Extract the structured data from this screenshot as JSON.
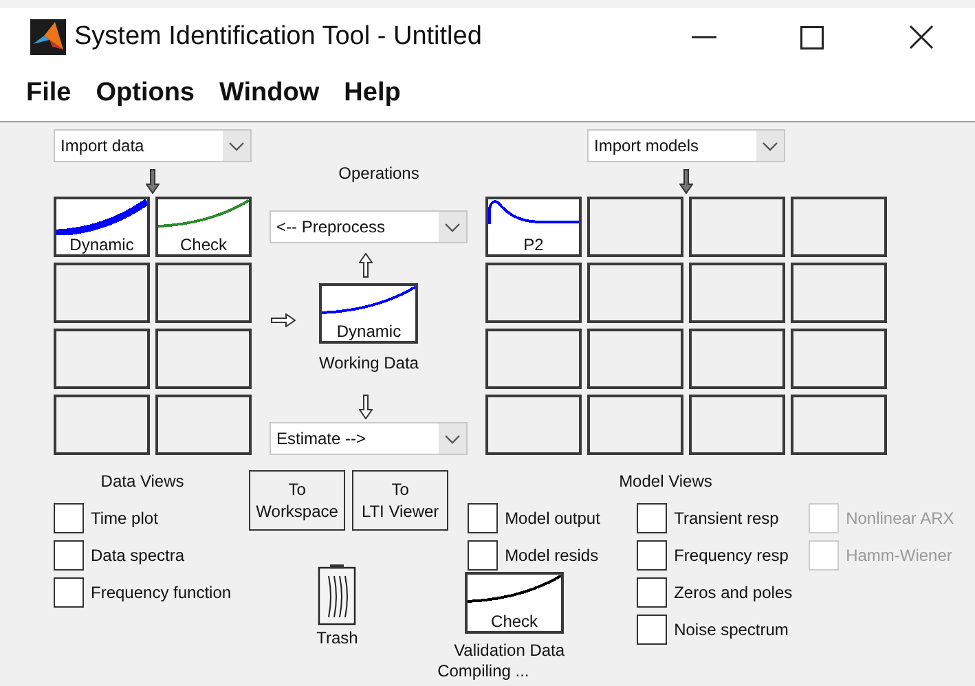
{
  "window": {
    "title": "System Identification Tool - Untitled"
  },
  "menu": [
    "File",
    "Options",
    "Window",
    "Help"
  ],
  "data_panel": {
    "import": {
      "value": "Import data"
    },
    "tiles": [
      {
        "kind": "thick-curve",
        "label": "Dynamic",
        "color": "#0000ff"
      },
      {
        "kind": "curve",
        "label": "Check",
        "color": "#2e8b2e"
      },
      {
        "kind": "empty"
      },
      {
        "kind": "empty"
      },
      {
        "kind": "empty"
      },
      {
        "kind": "empty"
      },
      {
        "kind": "empty"
      },
      {
        "kind": "empty"
      }
    ]
  },
  "operations": {
    "title": "Operations",
    "preprocess": {
      "value": "<-- Preprocess"
    },
    "working_data": {
      "tile": {
        "kind": "curve",
        "label": "Dynamic",
        "color": "#0000ff"
      },
      "caption": "Working Data"
    },
    "estimate": {
      "value": "Estimate -->"
    }
  },
  "model_panel": {
    "import": {
      "value": "Import models"
    },
    "tiles": [
      {
        "kind": "step",
        "label": "P2",
        "color": "#0000ff"
      },
      {
        "kind": "empty"
      },
      {
        "kind": "empty"
      },
      {
        "kind": "empty"
      },
      {
        "kind": "empty"
      },
      {
        "kind": "empty"
      },
      {
        "kind": "empty"
      },
      {
        "kind": "empty"
      },
      {
        "kind": "empty"
      },
      {
        "kind": "empty"
      },
      {
        "kind": "empty"
      },
      {
        "kind": "empty"
      },
      {
        "kind": "empty"
      },
      {
        "kind": "empty"
      },
      {
        "kind": "empty"
      },
      {
        "kind": "empty"
      }
    ]
  },
  "data_views": {
    "title": "Data Views",
    "options": [
      {
        "label": "Time plot",
        "checked": false
      },
      {
        "label": "Data spectra",
        "checked": false
      },
      {
        "label": "Frequency function",
        "checked": false
      }
    ]
  },
  "buttons": [
    "To\nWorkspace",
    "To\nLTI Viewer"
  ],
  "trash": {
    "label": "Trash"
  },
  "validation": {
    "options": [
      {
        "label": "Model output",
        "checked": false
      },
      {
        "label": "Model resids",
        "checked": false
      }
    ],
    "tile": {
      "kind": "curve",
      "label": "Check",
      "color": "#000000"
    },
    "caption": "Validation Data",
    "status": "Compiling ..."
  },
  "model_views": {
    "title": "Model Views",
    "options": [
      {
        "label": "Transient resp",
        "checked": false,
        "disabled": false
      },
      {
        "label": "Frequency resp",
        "checked": false,
        "disabled": false
      },
      {
        "label": "Zeros and poles",
        "checked": false,
        "disabled": false
      },
      {
        "label": "Noise spectrum",
        "checked": false,
        "disabled": false
      }
    ],
    "extra_options": [
      {
        "label": "Nonlinear ARX",
        "checked": false,
        "disabled": true
      },
      {
        "label": "Hamm-Wiener",
        "checked": false,
        "disabled": true
      }
    ]
  }
}
